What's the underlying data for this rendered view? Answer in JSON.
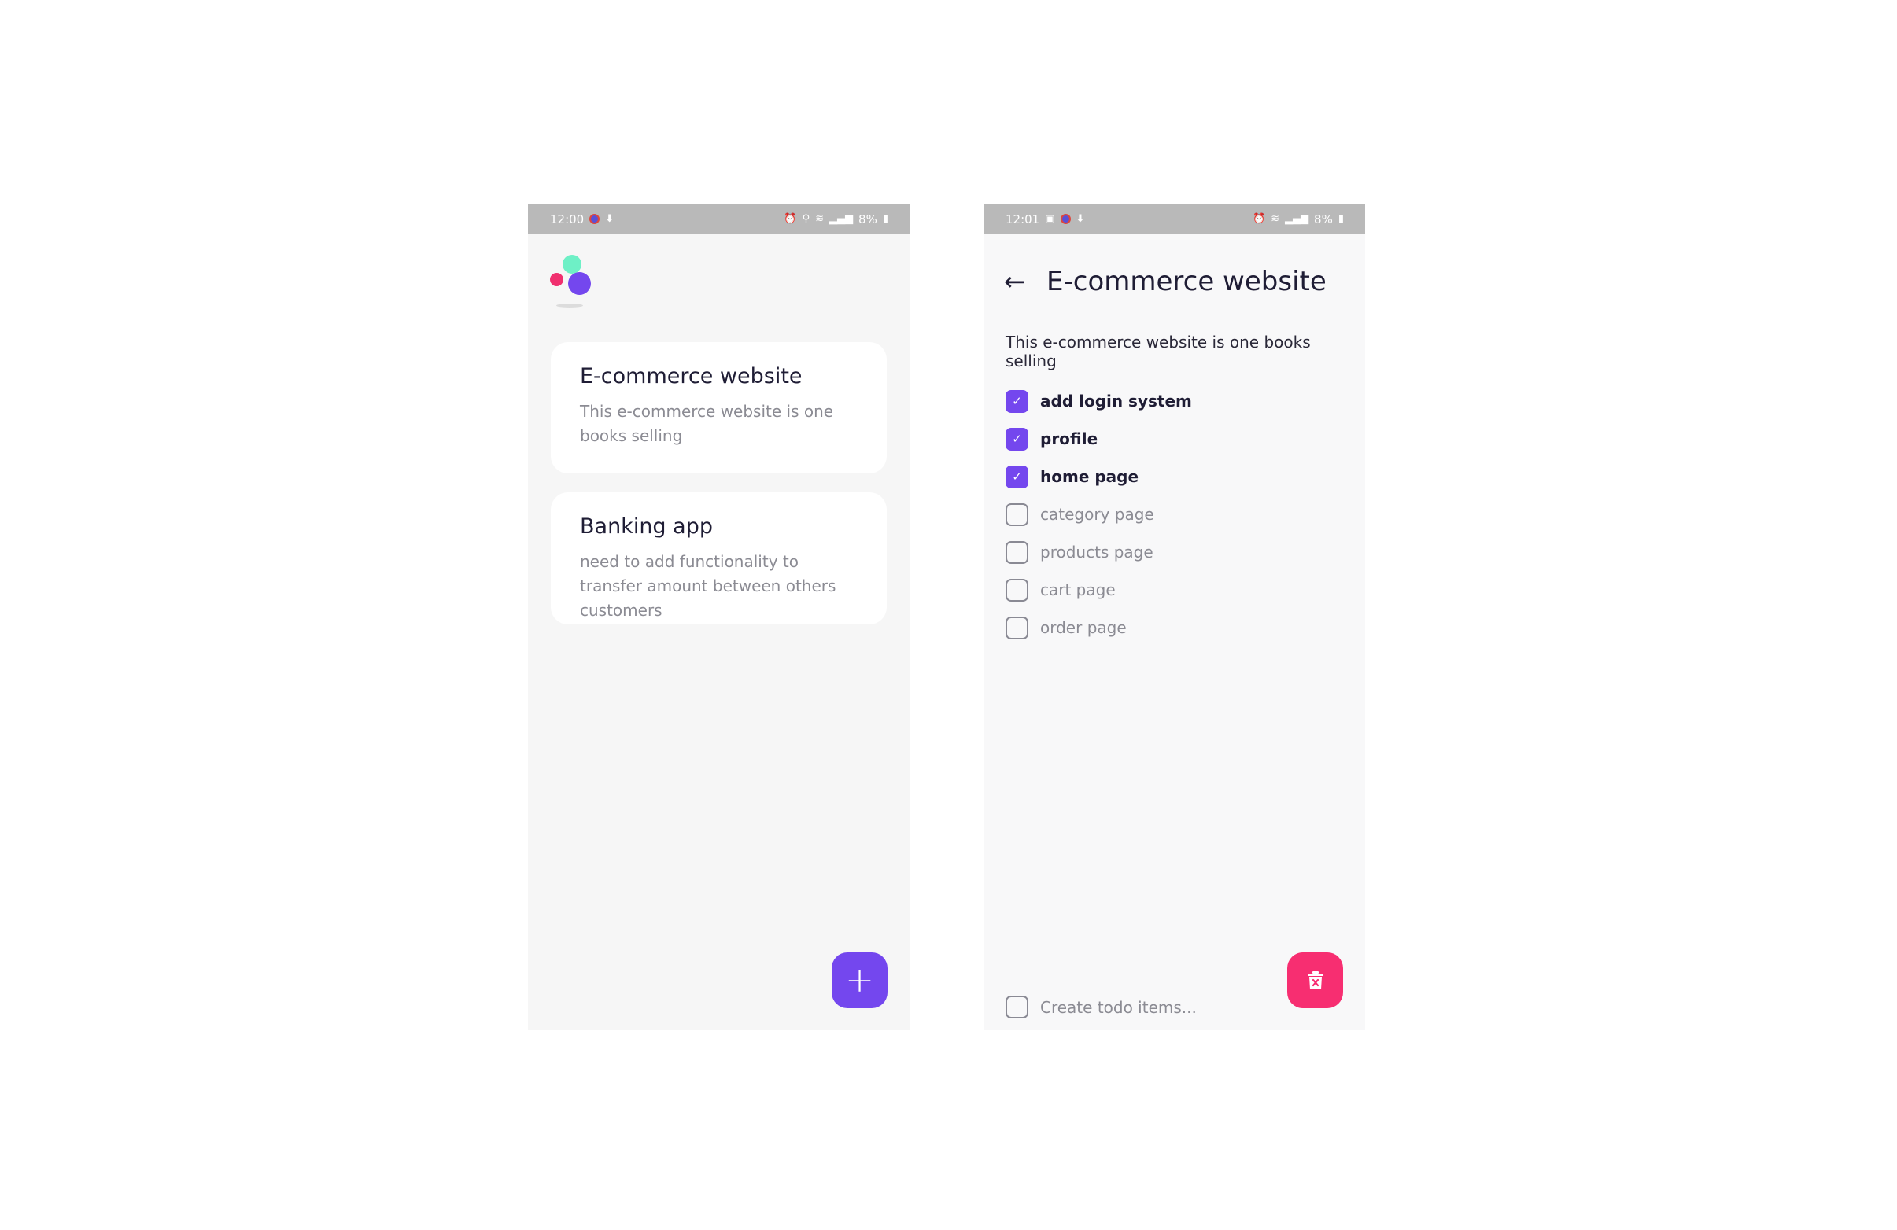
{
  "left_screen": {
    "status_bar": {
      "time": "12:00",
      "battery": "8%"
    },
    "projects": [
      {
        "title": "E-commerce website",
        "description": "This e-commerce website is one books selling"
      },
      {
        "title": "Banking app",
        "description": "need to add functionality to transfer amount between others customers"
      }
    ],
    "fab_add_label": "+"
  },
  "right_screen": {
    "status_bar": {
      "time": "12:01",
      "battery": "8%"
    },
    "title": "E-commerce website",
    "back_icon": "arrow-left-icon",
    "description": "This e-commerce website is one books selling",
    "todos": [
      {
        "label": "add login system",
        "done": true
      },
      {
        "label": "profile",
        "done": true
      },
      {
        "label": "home page",
        "done": true
      },
      {
        "label": "category page",
        "done": false
      },
      {
        "label": "products page",
        "done": false
      },
      {
        "label": "cart page",
        "done": false
      },
      {
        "label": "order page",
        "done": false
      }
    ],
    "create_placeholder": "Create todo items...",
    "delete_icon": "trash-icon"
  },
  "colors": {
    "accent_purple": "#7447ee",
    "accent_pink": "#f72e71",
    "logo_teal": "#6ef0c6",
    "logo_pink": "#f0306f",
    "text_dark": "#1f1d35",
    "text_muted": "#8b8b93"
  }
}
